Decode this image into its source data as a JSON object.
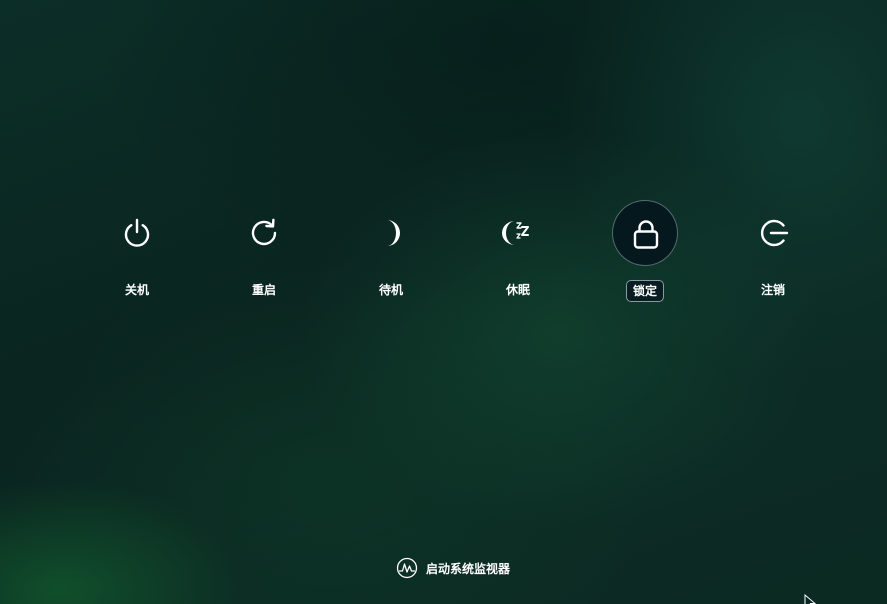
{
  "power_actions": {
    "items": [
      {
        "label": "关机",
        "icon": "power-icon"
      },
      {
        "label": "重启",
        "icon": "restart-icon"
      },
      {
        "label": "待机",
        "icon": "standby-moon-icon"
      },
      {
        "label": "休眠",
        "icon": "hibernate-icon"
      },
      {
        "label": "锁定",
        "icon": "lock-icon",
        "selected": true
      },
      {
        "label": "注销",
        "icon": "logout-icon"
      }
    ]
  },
  "system_monitor": {
    "label": "启动系统监视器",
    "icon": "system-monitor-icon"
  }
}
